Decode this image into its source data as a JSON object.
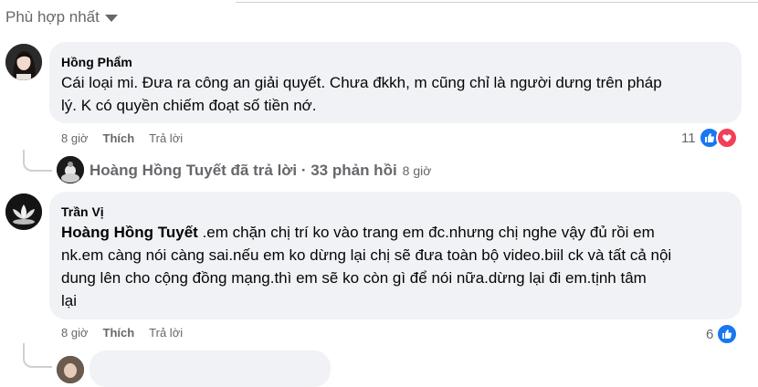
{
  "sort": {
    "label": "Phù hợp nhất"
  },
  "comments": [
    {
      "author": "Hồng Phẩm",
      "text": "Cái loại mi. Đưa ra công an giải quyết. Chưa đkkh, m cũng chỉ là người dưng trên pháp lý. K có quyền chiếm đoạt số tiền nớ.",
      "line1": "Cái loại mi. Đưa ra công an giải quyết. Chưa đkkh, m cũng chỉ là người dưng trên pháp",
      "line2": "lý. K có quyền chiếm đoạt số tiền nớ.",
      "time": "8 giờ",
      "like_label": "Thích",
      "reply_label": "Trả lời",
      "reaction_count": "11",
      "reactions": [
        "like-icon",
        "love-icon"
      ],
      "replies_summary": {
        "text": "Hoàng Hồng Tuyết đã trả lời · 33 phản hồi",
        "time": "8 giờ"
      }
    },
    {
      "author": "Trần Vị",
      "tag": "Hoàng Hồng Tuyết",
      "line1": " .em chặn chị trí ko vào trang em đc.nhưng chị nghe vậy đủ rồi em",
      "line2": "nk.em càng nói càng sai.nếu em ko dừng lại chị sẽ đưa toàn bộ video.biil ck và tất cả nội",
      "line3": "dung lên cho cộng đồng mạng.thì em sẽ ko còn gì để nói nữa.dừng lại đi em.tịnh tâm",
      "line4": "lại",
      "time": "8 giờ",
      "like_label": "Thích",
      "reply_label": "Trả lời",
      "reaction_count": "6",
      "reactions": [
        "like-icon"
      ]
    }
  ],
  "colors": {
    "bubble": "#f0f2f5",
    "meta": "#65676b",
    "like": "#1877f2",
    "love": "#f33e58"
  }
}
